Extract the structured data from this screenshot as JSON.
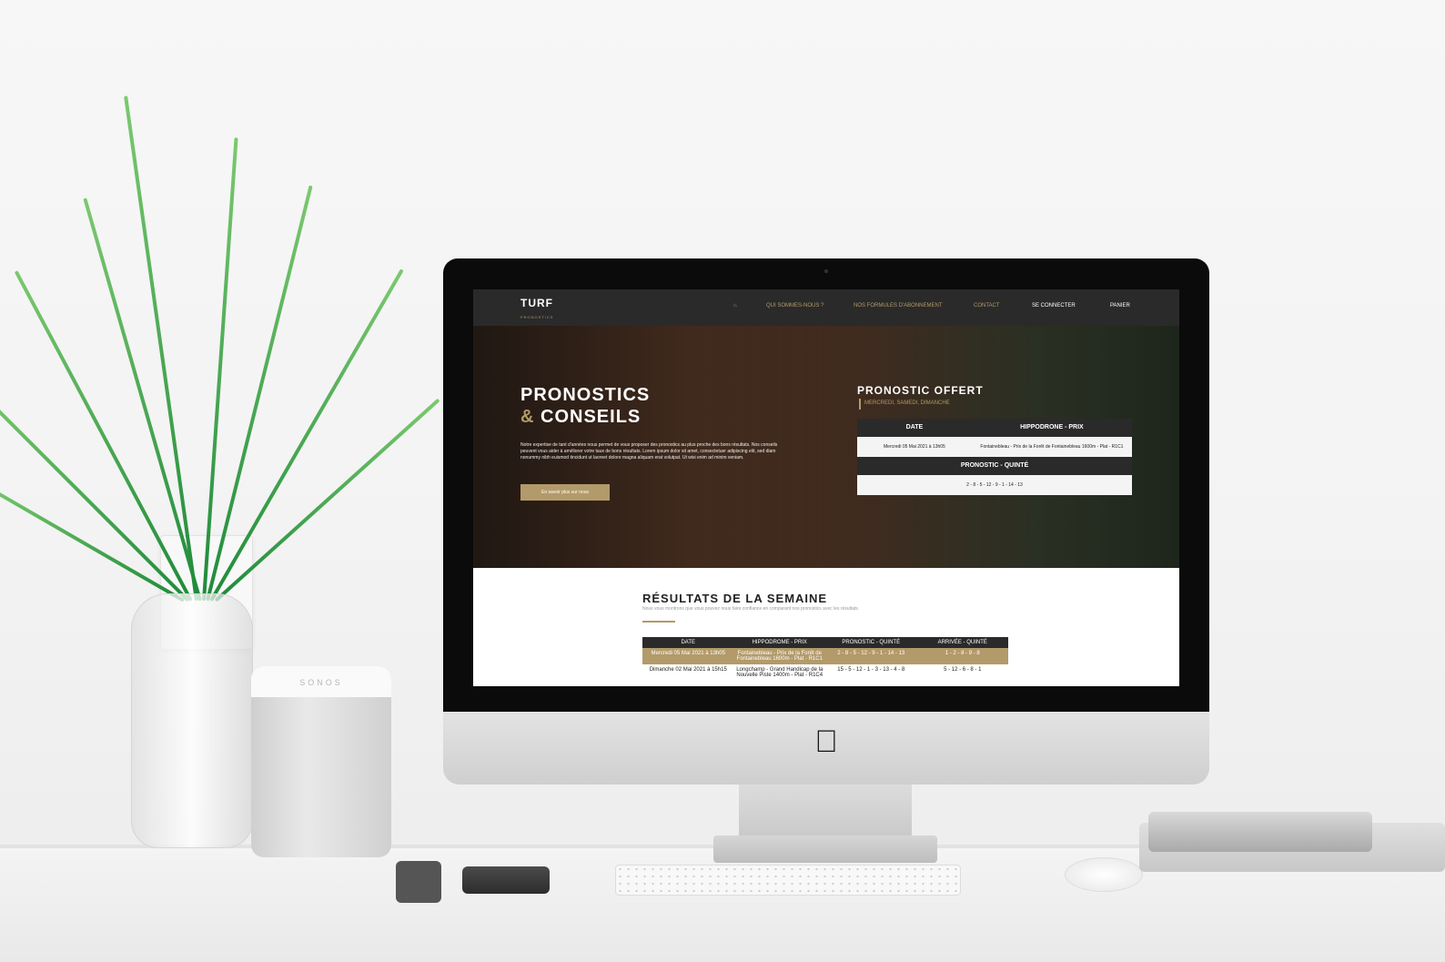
{
  "speaker_label": "SONOS",
  "site": {
    "logo": "TURF",
    "logo_sub": "PRONOSTICS",
    "nav": [
      {
        "label": "QUI SOMMES-NOUS ?"
      },
      {
        "label": "NOS FORMULES D'ABONNEMENT"
      },
      {
        "label": "CONTACT"
      },
      {
        "label": "SE CONNECTER"
      },
      {
        "label": "PANIER"
      }
    ],
    "hero": {
      "title_line1": "PRONOSTICS",
      "amp": "&",
      "title_line2": "CONSEILS",
      "text": "Notre expertise de tant d'années nous permet de vous proposer des pronostics au plus proche des bons résultats. Nos conseils peuvent vous aider à améliorer votre taux de bons résultats. Lorem ipsum dolor sit amet, consectetuer adipiscing elit, sed diam nonummy nibh euismod tincidunt ut laoreet dolore magna aliquam erat volutpat. Ut wisi enim ad minim veniam.",
      "button": "En savoir plus sur nous"
    },
    "offert": {
      "title": "PRONOSTIC OFFERT",
      "subtitle": "MERCREDI, SAMEDI, DIMANCHE",
      "col1": "DATE",
      "col2": "HIPPODRONE - PRIX",
      "date": "Mercredi 05 Mai 2021 à 13h05",
      "hippo": "Fontainebleau - Prix de la Forêt de Fontainebleau 1600m - Plat - R1C1",
      "quinte_label": "PRONOSTIC - QUINTÉ",
      "quinte": "2 - 8 - 5 - 12 - 9 - 1 - 14 - 13"
    },
    "results": {
      "title": "RÉSULTATS DE LA SEMAINE",
      "subtitle": "Nous vous montrons que vous pouvez nous faire confiance en comparant nos pronostics avec les résultats.",
      "headers": [
        "DATE",
        "HIPPODROME - PRIX",
        "PRONOSTIC - QUINTÉ",
        "ARRIVÉE - QUINTÉ"
      ],
      "rows": [
        [
          "Mercredi 05 Mai 2021 à 13h05",
          "Fontainebleau - Prix de la Forêt de Fontainebleau 1600m - Plat - R1C1",
          "2 - 8 - 5 - 12 - 9 - 1 - 14 - 13",
          "1 - 2 - 8 - 9 - 8"
        ],
        [
          "Dimanche 02 Mai 2021 à 15h15",
          "Longchamp - Grand Handicap de la Nouvelle Piste 1400m - Plat - R1C4",
          "15 - 5 - 12 - 1 - 3 - 13 - 4 - 8",
          "5 - 12 - 6 - 8 - 1"
        ]
      ]
    }
  },
  "colors": {
    "gold": "#b39a6a",
    "dark": "#2a2a2a"
  }
}
